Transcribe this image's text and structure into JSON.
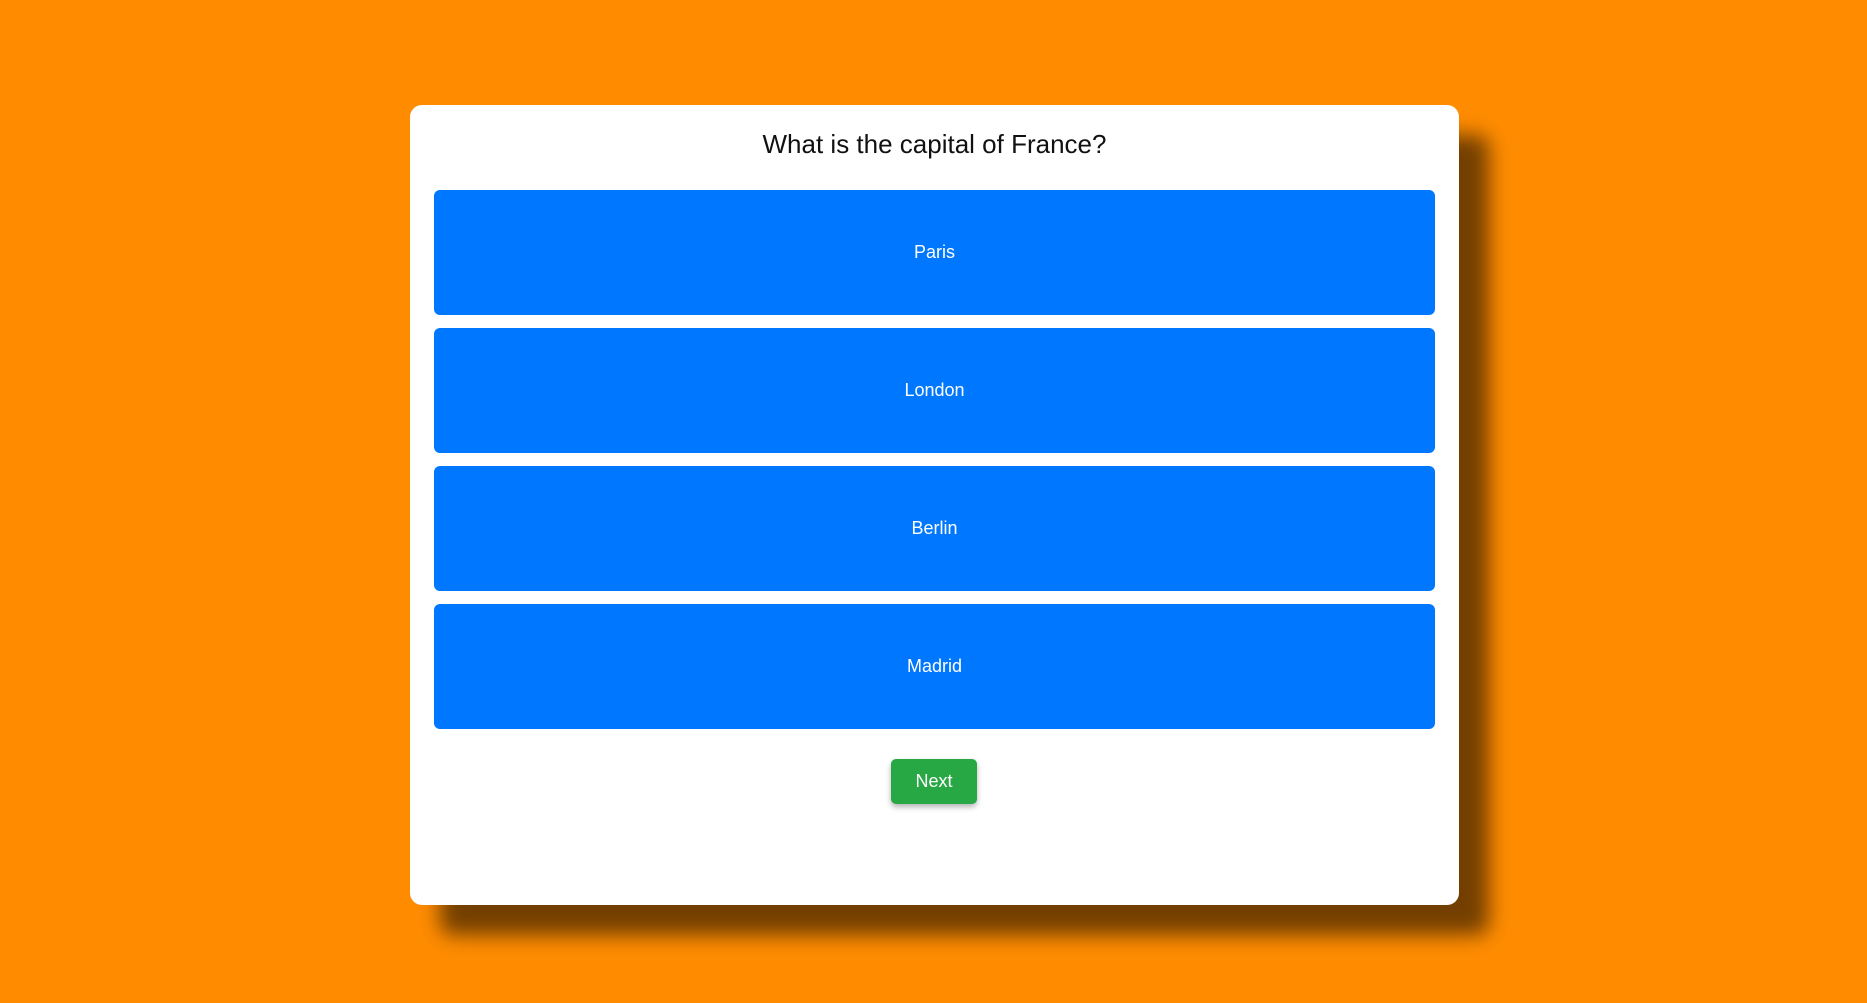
{
  "quiz": {
    "question": "What is the capital of France?",
    "options": [
      {
        "label": "Paris"
      },
      {
        "label": "London"
      },
      {
        "label": "Berlin"
      },
      {
        "label": "Madrid"
      }
    ],
    "next_label": "Next"
  },
  "colors": {
    "background": "#ff8c00",
    "card": "#ffffff",
    "option": "#0077ff",
    "next": "#28a745"
  }
}
